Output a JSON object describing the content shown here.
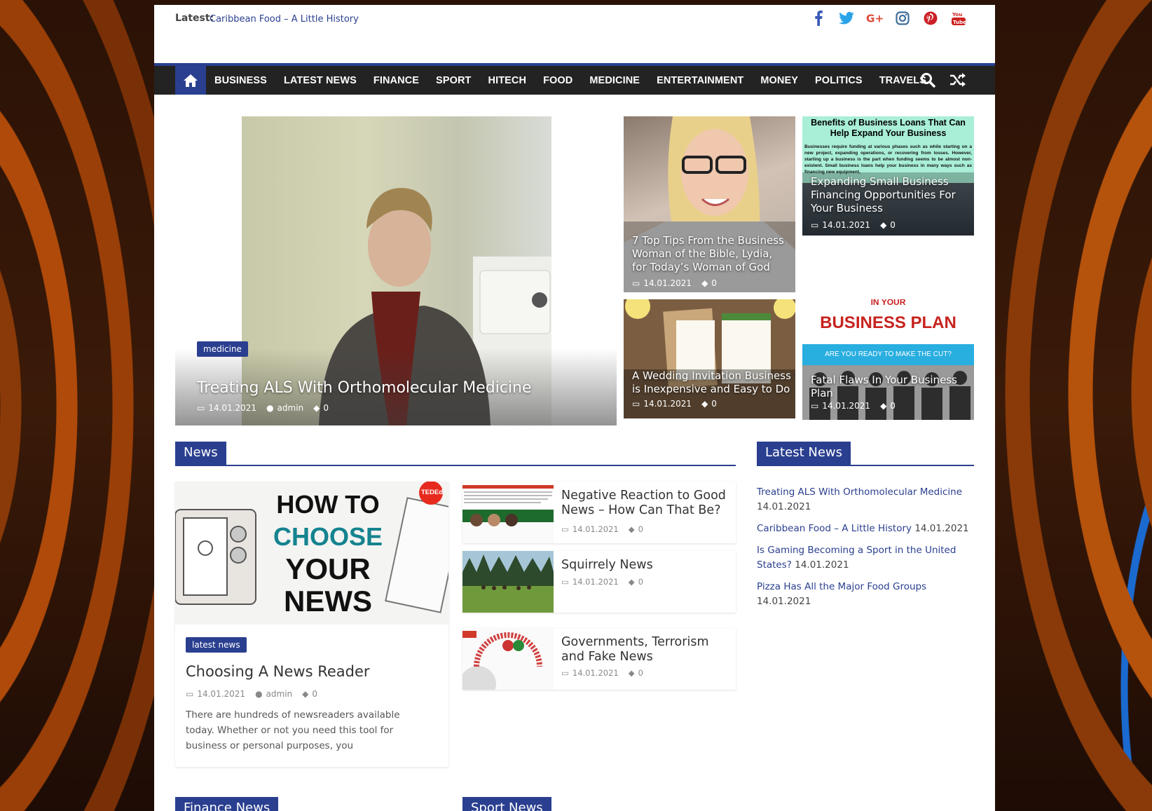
{
  "topbar": {
    "latest_label": "Latest:",
    "latest_link": "Caribbean Food – A Little History",
    "socials": [
      "facebook-icon",
      "twitter-icon",
      "google-plus-icon",
      "instagram-icon",
      "pinterest-icon",
      "youtube-icon"
    ]
  },
  "nav": {
    "items": [
      "BUSINESS",
      "LATEST NEWS",
      "FINANCE",
      "SPORT",
      "HITECH",
      "FOOD",
      "MEDICINE",
      "ENTERTAINMENT",
      "MONEY",
      "POLITICS",
      "TRAVELS"
    ]
  },
  "hero": {
    "category": "medicine",
    "title": "Treating ALS With Orthomolecular Medicine",
    "date": "14.01.2021",
    "author": "admin",
    "comments": "0"
  },
  "tiles": [
    {
      "title": "7 Top Tips From the Business Woman of the Bible, Lydia, for Today’s Woman of God",
      "date": "14.01.2021",
      "comments": "0"
    },
    {
      "title": "Expanding Small Business Financing Opportunities For Your Business",
      "date": "14.01.2021",
      "comments": "0",
      "image_heading": "Benefits of Business Loans That Can Help Expand Your Business",
      "image_text": "Businesses require funding at various phases such as while starting on a new project, expanding operations, or recovering from losses. However, starting up a business is the part when funding seems to be almost non-existent. Small business loans help your business in many ways such as financing new equipment,"
    },
    {
      "title": "A Wedding Invitation Business is Inexpensive and Easy to Do",
      "date": "14.01.2021",
      "comments": "0"
    },
    {
      "title": "Fatal Flaws In Your Business Plan",
      "date": "14.01.2021",
      "comments": "0",
      "image_top": "IN YOUR",
      "image_heading": "BUSINESS PLAN",
      "image_sub": "ARE YOU READY TO MAKE THE CUT?"
    }
  ],
  "sections": {
    "news": "News",
    "latest_news": "Latest News",
    "finance_news": "Finance News",
    "sport_news": "Sport News"
  },
  "news_big": {
    "image_lines": [
      "HOW TO",
      "CHOOSE",
      "YOUR",
      "NEWS"
    ],
    "image_badge": "TEDEd",
    "category": "latest news",
    "title": "Choosing A News Reader",
    "date": "14.01.2021",
    "author": "admin",
    "comments": "0",
    "excerpt": "There are hundreds of newsreaders available today. Whether or not you need this tool for business or personal purposes, you"
  },
  "news_small": [
    {
      "title": "Negative Reaction to Good News – How Can That Be?",
      "date": "14.01.2021",
      "comments": "0"
    },
    {
      "title": "Squirrely News",
      "date": "14.01.2021",
      "comments": "0"
    },
    {
      "title": "Governments, Terrorism and Fake News",
      "date": "14.01.2021",
      "comments": "0"
    }
  ],
  "latest_news": [
    {
      "title": "Treating ALS With Orthomolecular Medicine",
      "date": "14.01.2021"
    },
    {
      "title": "Caribbean Food – A Little History",
      "date": "14.01.2021"
    },
    {
      "title": "Is Gaming Becoming a Sport in the United States?",
      "date": "14.01.2021"
    },
    {
      "title": "Pizza Has All the Major Food Groups",
      "date": "14.01.2021"
    }
  ],
  "colors": {
    "accent": "#2a3f8f",
    "nav_bg": "#232323"
  }
}
